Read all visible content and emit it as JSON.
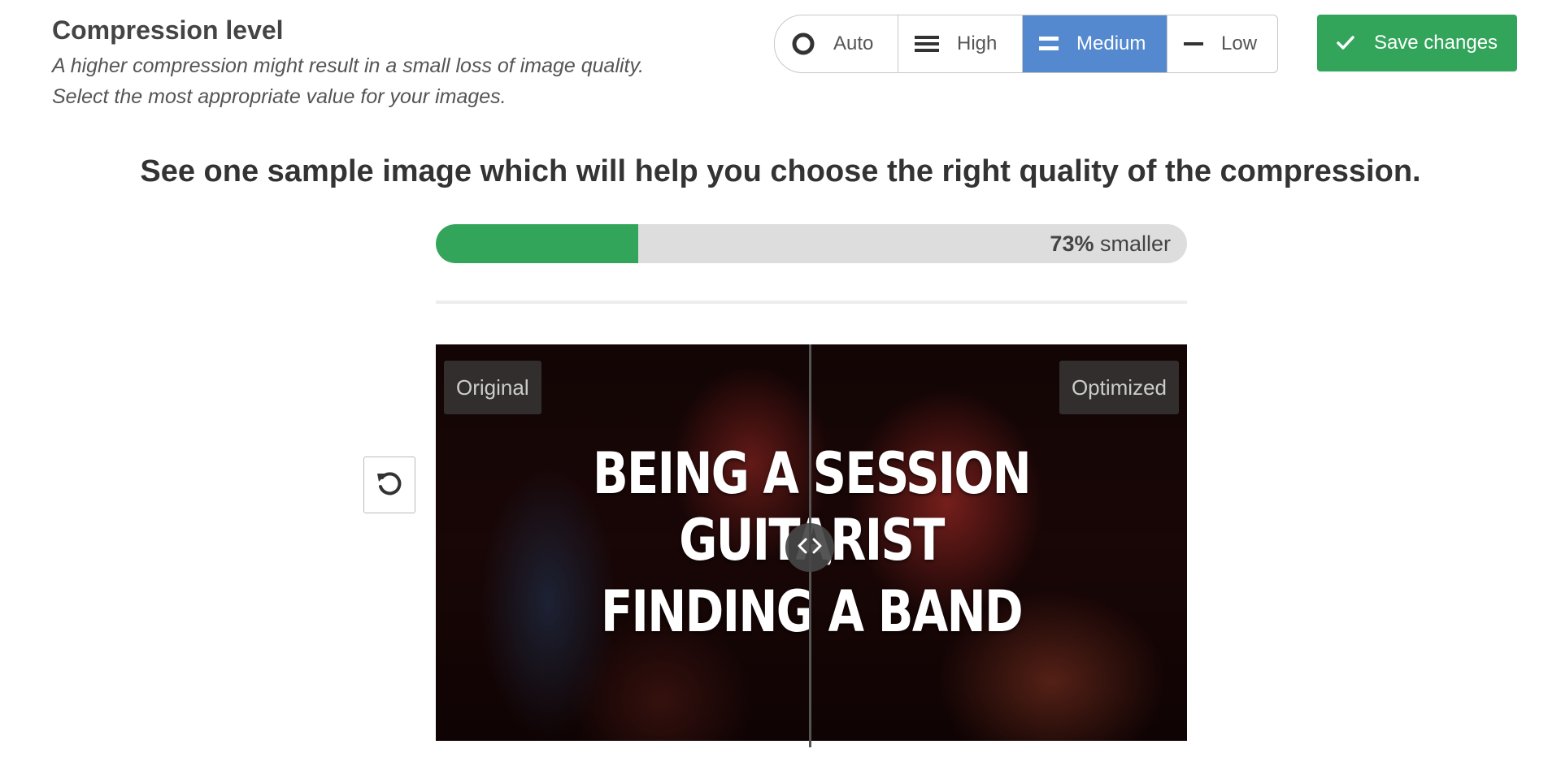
{
  "compression": {
    "title": "Compression level",
    "description_line1": "A higher compression might result in a small loss of image quality.",
    "description_line2": "Select the most appropriate value for your images.",
    "options": [
      {
        "label": "Auto",
        "icon": "circle-ring-icon",
        "active": false
      },
      {
        "label": "High",
        "icon": "three-bars-icon",
        "active": false
      },
      {
        "label": "Medium",
        "icon": "two-bars-icon",
        "active": true
      },
      {
        "label": "Low",
        "icon": "one-bar-icon",
        "active": false
      }
    ],
    "selected": "Medium"
  },
  "save_button": {
    "label": "Save changes",
    "icon": "checkmark-icon"
  },
  "sample": {
    "heading": "See one sample image which will help you choose the right quality of the compression.",
    "savings_percent": 73,
    "savings_percent_text": "73%",
    "savings_suffix": "smaller",
    "progress_fill_fraction": 0.27,
    "original_label": "Original",
    "optimized_label": "Optimized",
    "image_text_line1": "BEING A SESSION GUITARIST",
    "image_text_separator": ",",
    "image_text_line2": "FINDING A BAND",
    "reset_icon": "refresh-icon",
    "handle_icon": "code-arrows-icon"
  },
  "colors": {
    "accent_green": "#33a55a",
    "active_blue": "#5488cf",
    "progress_track": "#dddddd"
  }
}
